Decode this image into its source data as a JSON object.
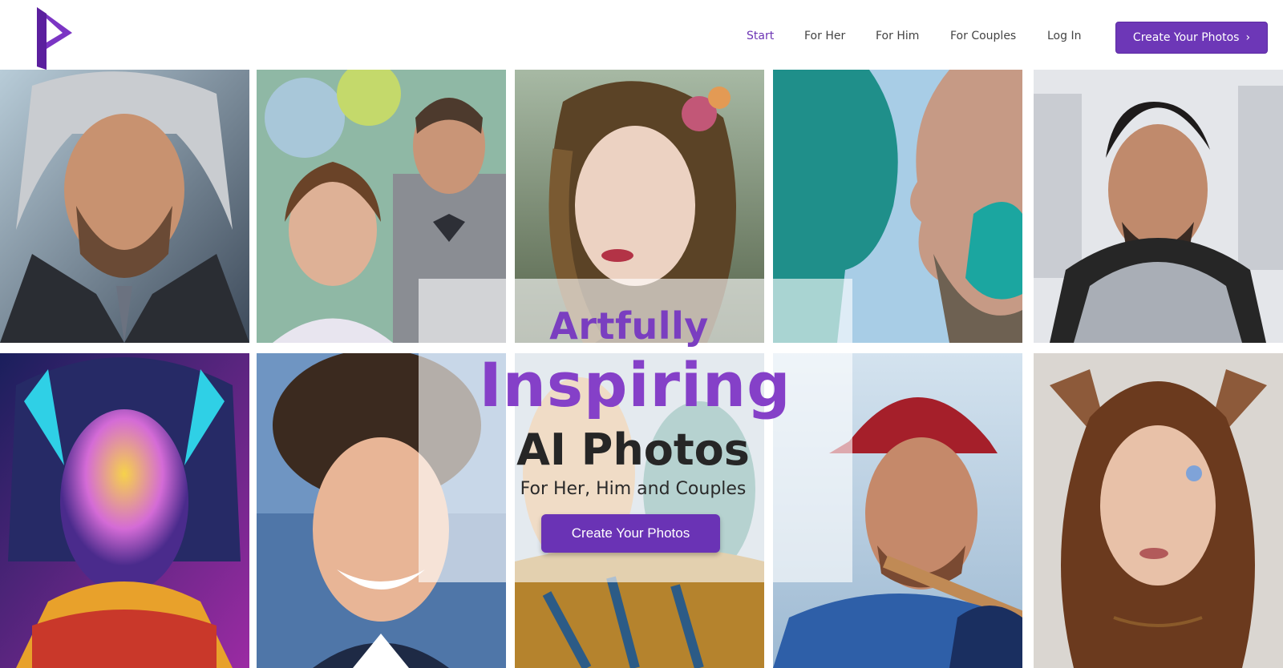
{
  "brand": {
    "logo_icon": "p-logo-icon",
    "accent": "#6d37b7"
  },
  "nav": {
    "items": [
      {
        "label": "Start",
        "active": true
      },
      {
        "label": "For Her",
        "active": false
      },
      {
        "label": "For Him",
        "active": false
      },
      {
        "label": "For Couples",
        "active": false
      },
      {
        "label": "Log In",
        "active": false
      }
    ],
    "cta_label": "Create Your Photos",
    "cta_icon": "chevron-right-icon"
  },
  "hero": {
    "line1": "Artfully",
    "line2": "Inspiring",
    "line3": "AI Photos",
    "subtitle": "For Her, Him and Couples",
    "button_label": "Create Your Photos"
  },
  "gallery": {
    "tiles": [
      {
        "subject": "man-silver-hair-portrait"
      },
      {
        "subject": "couple-formal-portrait"
      },
      {
        "subject": "woman-flower-crown-portrait"
      },
      {
        "subject": "couple-teal-mosaic-portrait"
      },
      {
        "subject": "man-armor-portrait"
      },
      {
        "subject": "woman-neon-armor-portrait"
      },
      {
        "subject": "young-man-curly-hair-portrait"
      },
      {
        "subject": "fantasy-figures-portrait"
      },
      {
        "subject": "baseball-player-portrait"
      },
      {
        "subject": "woman-elf-portrait"
      }
    ]
  }
}
